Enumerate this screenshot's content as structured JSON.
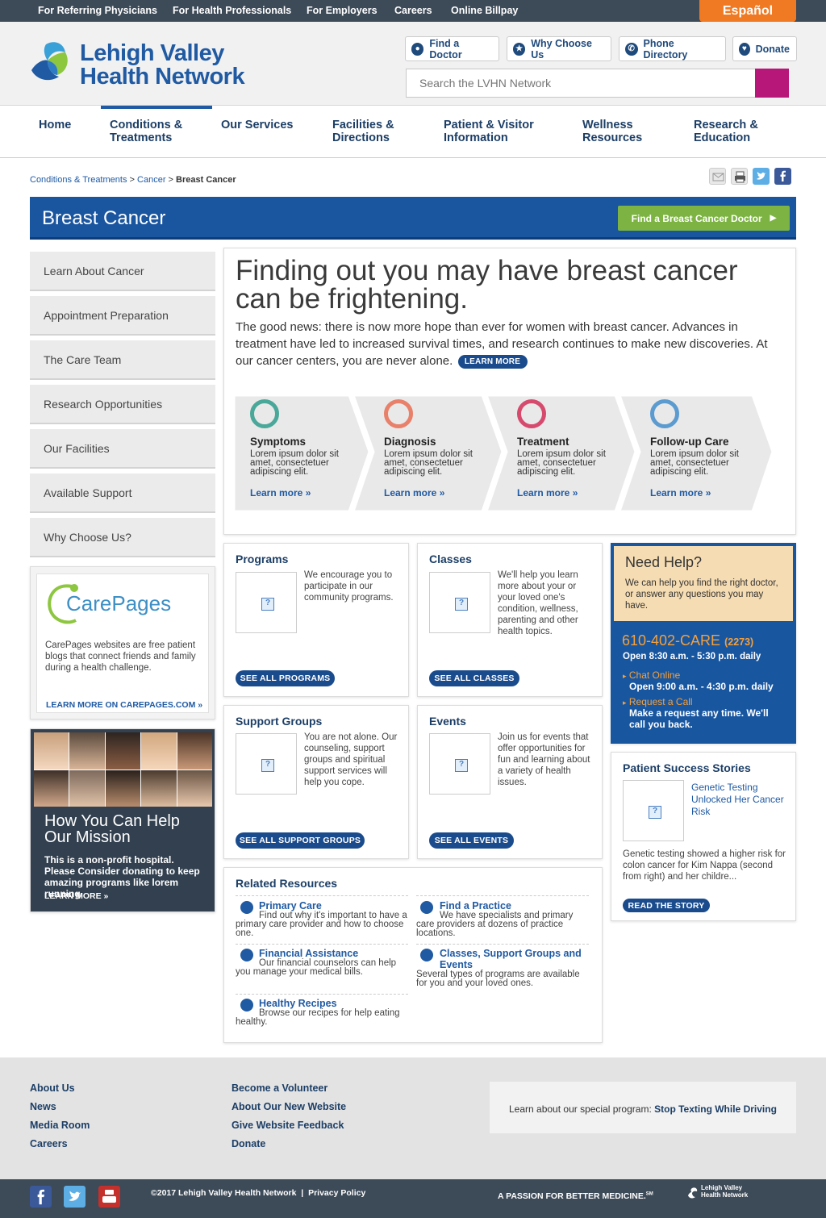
{
  "topbar": {
    "links": [
      "For Referring Physicians",
      "For Health Professionals",
      "For Employers",
      "Careers",
      "Online Billpay"
    ],
    "espanol": "Español"
  },
  "logo": {
    "line1": "Lehigh Valley",
    "line2": "Health Network"
  },
  "header_buttons": {
    "find_doctor": "Find a Doctor",
    "why_choose": "Why Choose Us",
    "phone_directory": "Phone Directory",
    "donate": "Donate"
  },
  "search": {
    "placeholder": "Search the LVHN Network"
  },
  "nav": [
    {
      "l1": "Home",
      "l2": ""
    },
    {
      "l1": "Conditions &",
      "l2": "Treatments"
    },
    {
      "l1": "Our Services",
      "l2": ""
    },
    {
      "l1": "Facilities &",
      "l2": "Directions"
    },
    {
      "l1": "Patient & Visitor",
      "l2": "Information"
    },
    {
      "l1": "Wellness",
      "l2": "Resources"
    },
    {
      "l1": "Research &",
      "l2": "Education"
    }
  ],
  "breadcrumb": {
    "c1": "Conditions & Treatments",
    "c2": "Cancer",
    "current": "Breast Cancer",
    "sep": ">"
  },
  "page_title": "Breast Cancer",
  "find_doctor_cta": "Find a Breast Cancer Doctor",
  "side_menu": [
    "Learn About Cancer",
    "Appointment Preparation",
    "The Care Team",
    "Research Opportunities",
    "Our Facilities",
    "Available Support",
    "Why Choose Us?"
  ],
  "carepages": {
    "logo": "CarePages",
    "text": "CarePages websites are free patient blogs that connect friends and family during a health challenge.",
    "link": "LEARN MORE ON CAREPAGES.COM »"
  },
  "mission": {
    "title": "How You Can Help Our Mission",
    "text": "This is a non-profit hospital. Please Consider donating to keep amazing programs like lorem running.",
    "link": "LEARN MORE »"
  },
  "hero": {
    "headline1": "Finding out you may have breast cancer",
    "headline2": "can be frightening.",
    "body": "The good news: there is now more hope than ever for women with breast cancer. Advances in treatment have led to increased survival times, and research continues to make new discoveries. At our cancer centers, you are never alone.",
    "learn_more": "LEARN MORE"
  },
  "steps": [
    {
      "title": "Symptoms",
      "text": "Lorem ipsum dolor sit amet, consectetuer adipiscing elit.",
      "link": "Learn more »",
      "color": "#4aa89a"
    },
    {
      "title": "Diagnosis",
      "text": "Lorem ipsum dolor sit amet, consectetuer adipiscing elit.",
      "link": "Learn more »",
      "color": "#e8806a"
    },
    {
      "title": "Treatment",
      "text": "Lorem ipsum dolor sit amet, consectetuer adipiscing elit.",
      "link": "Learn more »",
      "color": "#d64a6e"
    },
    {
      "title": "Follow-up Care",
      "text": "Lorem ipsum dolor sit amet, consectetuer adipiscing elit.",
      "link": "Learn more »",
      "color": "#5b9bd0"
    }
  ],
  "cards": {
    "programs": {
      "title": "Programs",
      "text": "We encourage you to participate in our community programs.",
      "button": "SEE ALL PROGRAMS"
    },
    "classes": {
      "title": "Classes",
      "text": "We'll help you learn more about your or your loved one's condition, wellness, parenting and other health topics.",
      "button": "SEE ALL CLASSES"
    },
    "support": {
      "title": "Support Groups",
      "text": "You are not alone. Our counseling, support groups and spiritual support services will help you cope.",
      "button": "SEE ALL SUPPORT GROUPS"
    },
    "events": {
      "title": "Events",
      "text": "Join us for events that offer opportunities for fun and learning about a variety of health issues.",
      "button": "SEE ALL EVENTS"
    }
  },
  "resources": {
    "title": "Related Resources",
    "items": [
      {
        "title": "Primary Care",
        "text": "Find out why it's important to have a primary care provider and how to choose one."
      },
      {
        "title": "Find a Practice",
        "text": "We have specialists and primary care providers at dozens of practice locations."
      },
      {
        "title": "Financial Assistance",
        "text": "Our financial counselors can help you manage your medical bills."
      },
      {
        "title": "Classes, Support Groups and Events",
        "text": "Several types of programs are available for you and your loved ones."
      },
      {
        "title": "Healthy Recipes",
        "text": "Browse our recipes for help eating healthy."
      }
    ]
  },
  "need_help": {
    "title": "Need Help?",
    "text": "We can help you find the right doctor, or answer any questions you may have.",
    "phone": "610-402-CARE",
    "phone_num": "(2273)",
    "hours": "Open 8:30 a.m. - 5:30 p.m. daily",
    "chat": "Chat Online",
    "chat_hours": "Open 9:00 a.m. - 4:30 p.m. daily",
    "request": "Request a Call",
    "request_text": "Make a request any time. We'll call you back."
  },
  "success": {
    "title": "Patient Success Stories",
    "link": "Genetic Testing Unlocked Her Cancer Risk",
    "text": "Genetic testing showed a higher risk for colon cancer for Kim Nappa (second from right) and her childre...",
    "button": "READ THE STORY"
  },
  "footer": {
    "col1": [
      "About Us",
      "News",
      "Media Room",
      "Careers"
    ],
    "col2": [
      "Become a Volunteer",
      "About Our New Website",
      "Give Website Feedback",
      "Donate"
    ],
    "promo_text": "Learn about our special program:",
    "promo_link": "Stop Texting While Driving",
    "copyright": "©2017 Lehigh Valley Health Network",
    "privacy": "Privacy Policy",
    "tagline": "A PASSION FOR BETTER MEDICINE.",
    "tagline_sm": "SM",
    "logo_small1": "Lehigh Valley",
    "logo_small2": "Health Network"
  },
  "colors": {
    "brand_blue": "#1a55a0",
    "accent_green": "#7cb342",
    "accent_orange": "#ef7a23",
    "search_magenta": "#b8177a"
  }
}
